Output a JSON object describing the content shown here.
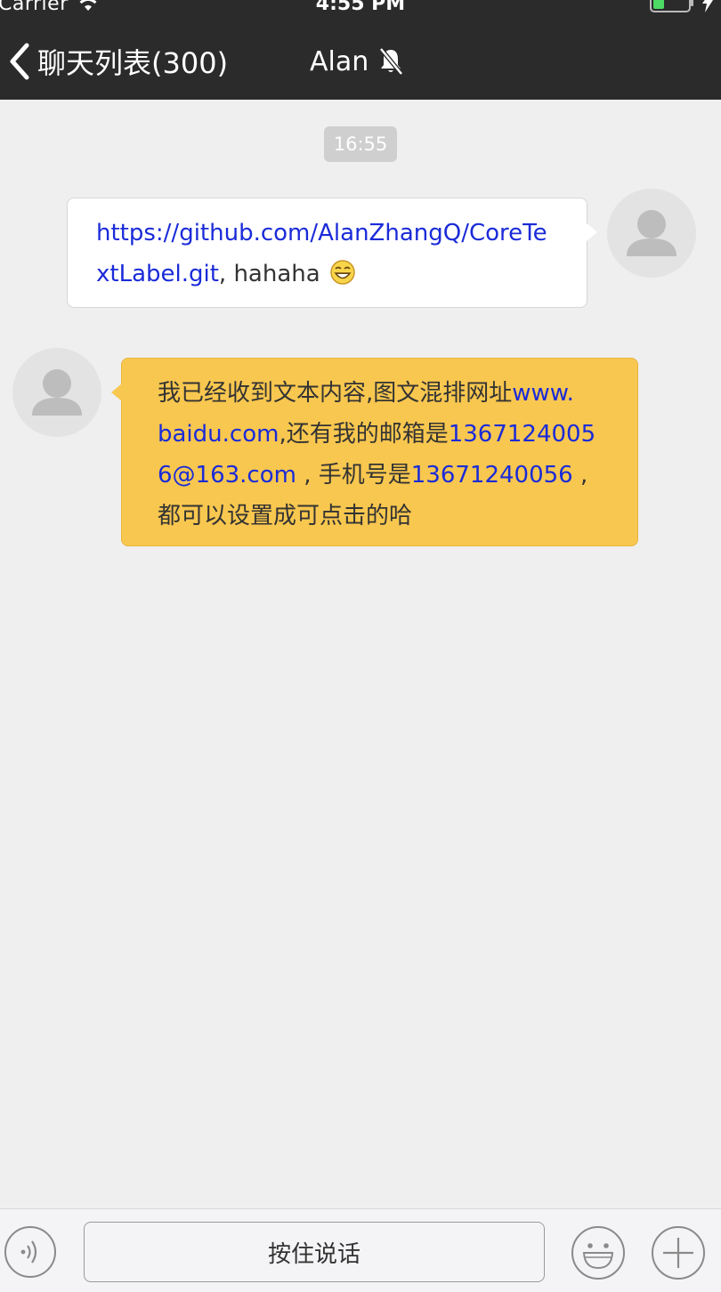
{
  "status_bar": {
    "carrier": "Carrier",
    "time": "4:55 PM",
    "icons": [
      "wifi-icon",
      "battery-icon",
      "charging-icon"
    ]
  },
  "nav": {
    "back_label": "聊天列表(300)",
    "title": "Alan",
    "icons": [
      "chevron-left-icon",
      "mute-bell-icon"
    ]
  },
  "chat": {
    "timestamp": "16:55",
    "messages": [
      {
        "side": "right",
        "link_part1": "https://github.com/AlanZhangQ/CoreTe",
        "link_part2": "xtLabel.git",
        "text_after": ", hahaha",
        "emoji": "grinning-emoji-icon"
      },
      {
        "side": "left",
        "text_1": "我已经收到文本内容,图文混排网址",
        "link_url_1": "www.",
        "link_url_2": "baidu.com",
        "text_2": ",还有我的邮箱是",
        "link_email_1": "1367124005",
        "link_email_2": "6@163.com",
        "text_3": " , 手机号是",
        "link_phone": "13671240056",
        "text_4": " ,",
        "text_5": "都可以设置成可点击的哈"
      }
    ]
  },
  "input_bar": {
    "hold_to_talk_label": "按住说话",
    "icons": [
      "voice-icon",
      "emoji-icon",
      "plus-icon"
    ]
  },
  "colors": {
    "nav_background": "#2b2b2b",
    "chat_background": "#efefef",
    "incoming_bubble": "#f8c74f",
    "outgoing_bubble": "#ffffff",
    "link": "#1a2bd8"
  }
}
